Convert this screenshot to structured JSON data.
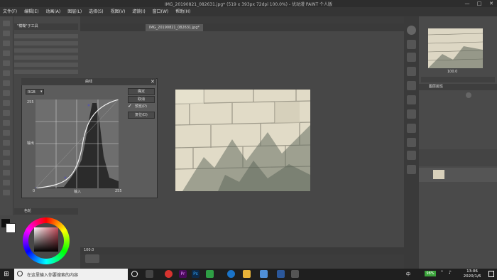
{
  "window": {
    "title": "IMG_20190821_082631.jpg* (519 x 393px 72dpi 100.0%) - 优动漫 PAINT 个人版",
    "controls": [
      "—",
      "□",
      "✕"
    ]
  },
  "menubar": [
    "文件(F)",
    "编辑(E)",
    "动画(A)",
    "图层(L)",
    "选择(S)",
    "视图(V)",
    "滤镜(I)",
    "窗口(W)",
    "帮助(H)"
  ],
  "tabs": [
    "IMG_20190821_082631.jpg*"
  ],
  "dialog": {
    "title": "曲线",
    "channel": "RGB",
    "buttons": {
      "ok": "确定",
      "cancel": "取消",
      "preview": "预览(P)",
      "reset": "复位(D)"
    },
    "labels": {
      "output": "输出",
      "input": "输入",
      "max_top": "255",
      "min": "0",
      "max_right": "255"
    }
  },
  "leftpanel": {
    "subtool_label": "\"模糊\"子工具",
    "color_label": "色轮"
  },
  "rightpanel": {
    "zoom": "100.0",
    "layer_label": "图层属性"
  },
  "statusbar": {
    "zoom": "100.0"
  },
  "taskbar": {
    "search_placeholder": "在这里输入你要搜索的内容",
    "lang": "中",
    "battery": "98%",
    "time": "13:06",
    "date": "2020/1/6"
  },
  "colors": {
    "accent": "#c8a0a0"
  }
}
